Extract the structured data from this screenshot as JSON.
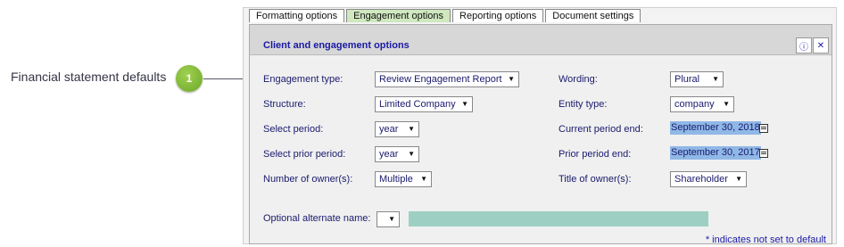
{
  "callout": {
    "label": "Financial statement defaults",
    "number": "1"
  },
  "tabs": [
    {
      "label": "Formatting options",
      "active": false
    },
    {
      "label": "Engagement options",
      "active": true
    },
    {
      "label": "Reporting options",
      "active": false
    },
    {
      "label": "Document settings",
      "active": false
    }
  ],
  "section": {
    "title": "Client and engagement options",
    "info_icon": "info-icon",
    "close_icon": "close-icon"
  },
  "left_fields": [
    {
      "label": "Engagement type:",
      "value": "Review Engagement Report"
    },
    {
      "label": "Structure:",
      "value": "Limited Company"
    },
    {
      "label": "Select period:",
      "value": "year"
    },
    {
      "label": "Select prior period:",
      "value": "year"
    },
    {
      "label": "Number of owner(s):",
      "value": "Multiple"
    }
  ],
  "right_fields": [
    {
      "label": "Wording:",
      "value": "Plural"
    },
    {
      "label": "Entity type:",
      "value": "company"
    },
    {
      "label": "Current period end:",
      "value": "September 30, 2018"
    },
    {
      "label": "Prior period end:",
      "value": "September 30, 2017"
    },
    {
      "label": "Title of owner(s):",
      "value": "Shareholder"
    }
  ],
  "alternate_name": {
    "label": "Optional alternate name:",
    "value": ""
  },
  "footnote": "* indicates not set to default",
  "colors": {
    "accent_text": "#1a1aa6",
    "active_tab": "#cfe8bf",
    "date_highlight": "#8fb8e6",
    "alt_input": "#9dcfc2",
    "callout_badge": "#7fbf3a"
  }
}
